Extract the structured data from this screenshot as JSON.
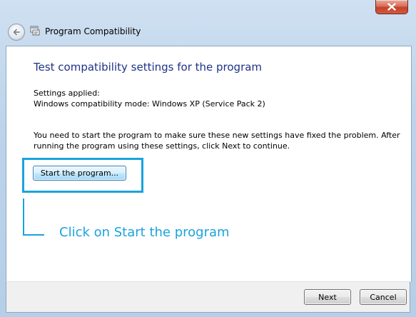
{
  "window": {
    "title": "Program Compatibility",
    "close_icon": "close-icon",
    "back_icon": "back-arrow-icon",
    "program_icon": "compatibility-icon"
  },
  "content": {
    "heading": "Test compatibility settings for the program",
    "settings_label": "Settings applied:",
    "settings_mode": "Windows compatibility mode: Windows XP (Service Pack 2)",
    "instructions": "You need to start the program to make sure these new settings have fixed the problem. After running the program using these settings, click Next to continue.",
    "start_button": "Start the program...",
    "callout": "Click on Start the program",
    "highlight_color": "#1aa3dd",
    "heading_color": "#1e3287"
  },
  "footer": {
    "next_label": "Next",
    "cancel_label": "Cancel"
  }
}
